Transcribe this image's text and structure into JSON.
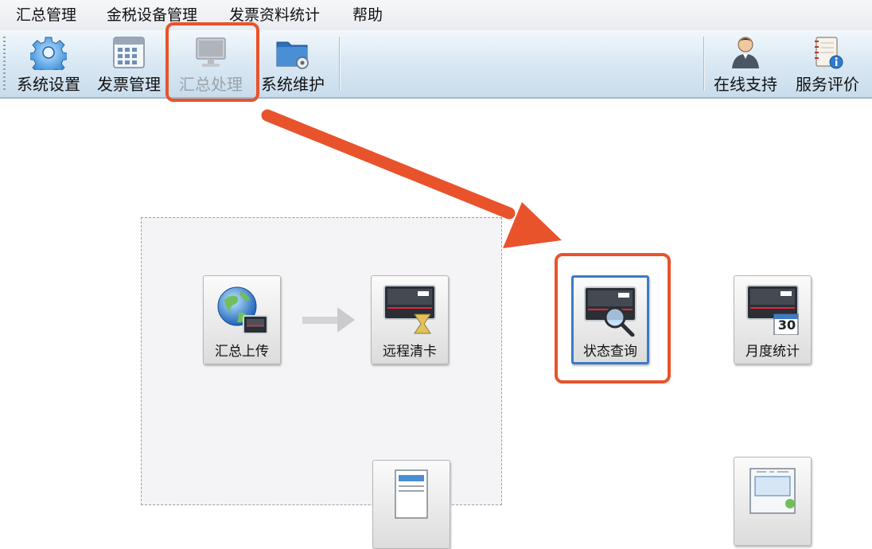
{
  "menu": {
    "items": [
      "汇总管理",
      "金税设备管理",
      "发票资料统计",
      "帮助"
    ]
  },
  "toolbar": {
    "system_settings": "系统设置",
    "invoice_management": "发票管理",
    "summary_processing": "汇总处理",
    "system_maintenance": "系统维护",
    "online_support": "在线支持",
    "service_rating": "服务评价"
  },
  "workspace": {
    "summary_upload": "汇总上传",
    "remote_clear_card": "远程清卡",
    "status_query": "状态查询",
    "monthly_statistics": "月度统计",
    "calendar_day": "30"
  },
  "colors": {
    "highlight": "#e8532c",
    "active_border": "#3c7bc8"
  }
}
